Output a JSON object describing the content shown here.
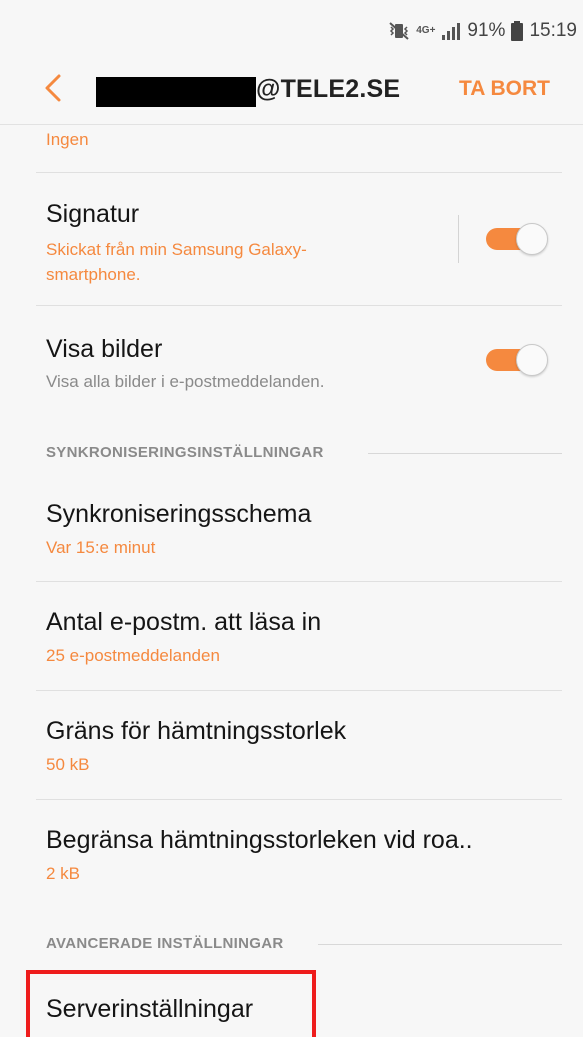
{
  "status_bar": {
    "network": "4G+",
    "battery_percent": "91%",
    "time": "15:19",
    "icons": [
      "vibrate-mute-icon",
      "network-4g-icon",
      "signal-icon",
      "battery-icon"
    ]
  },
  "app_bar": {
    "title": "@TELE2.SE",
    "action_label": "TA BORT",
    "back_icon": "chevron-left-icon"
  },
  "items": {
    "prev_value": "Ingen",
    "signature": {
      "title": "Signatur",
      "subtitle_line1": "Skickat från min Samsung Galaxy-",
      "subtitle_line2": "smartphone.",
      "enabled": true
    },
    "show_images": {
      "title": "Visa bilder",
      "subtitle": "Visa alla bilder i e-postmeddelanden.",
      "enabled": true
    }
  },
  "sections": {
    "sync": {
      "header": "SYNKRONISERINGSINSTÄLLNINGAR",
      "schedule": {
        "title": "Synkroniseringsschema",
        "value": "Var 15:e minut"
      },
      "load_count": {
        "title": "Antal e-postm. att läsa in",
        "value": "25 e-postmeddelanden"
      },
      "fetch_limit": {
        "title": "Gräns för hämtningsstorlek",
        "value": "50 kB"
      },
      "roaming_limit": {
        "title": "Begränsa hämtningsstorleken vid roa..",
        "value": "2 kB"
      }
    },
    "advanced": {
      "header": "AVANCERADE INSTÄLLNINGAR",
      "server_settings": {
        "title": "Serverinställningar"
      }
    }
  },
  "colors": {
    "accent": "#f5893f",
    "highlight": "#ee1c1c",
    "background": "#f7f7f7"
  }
}
